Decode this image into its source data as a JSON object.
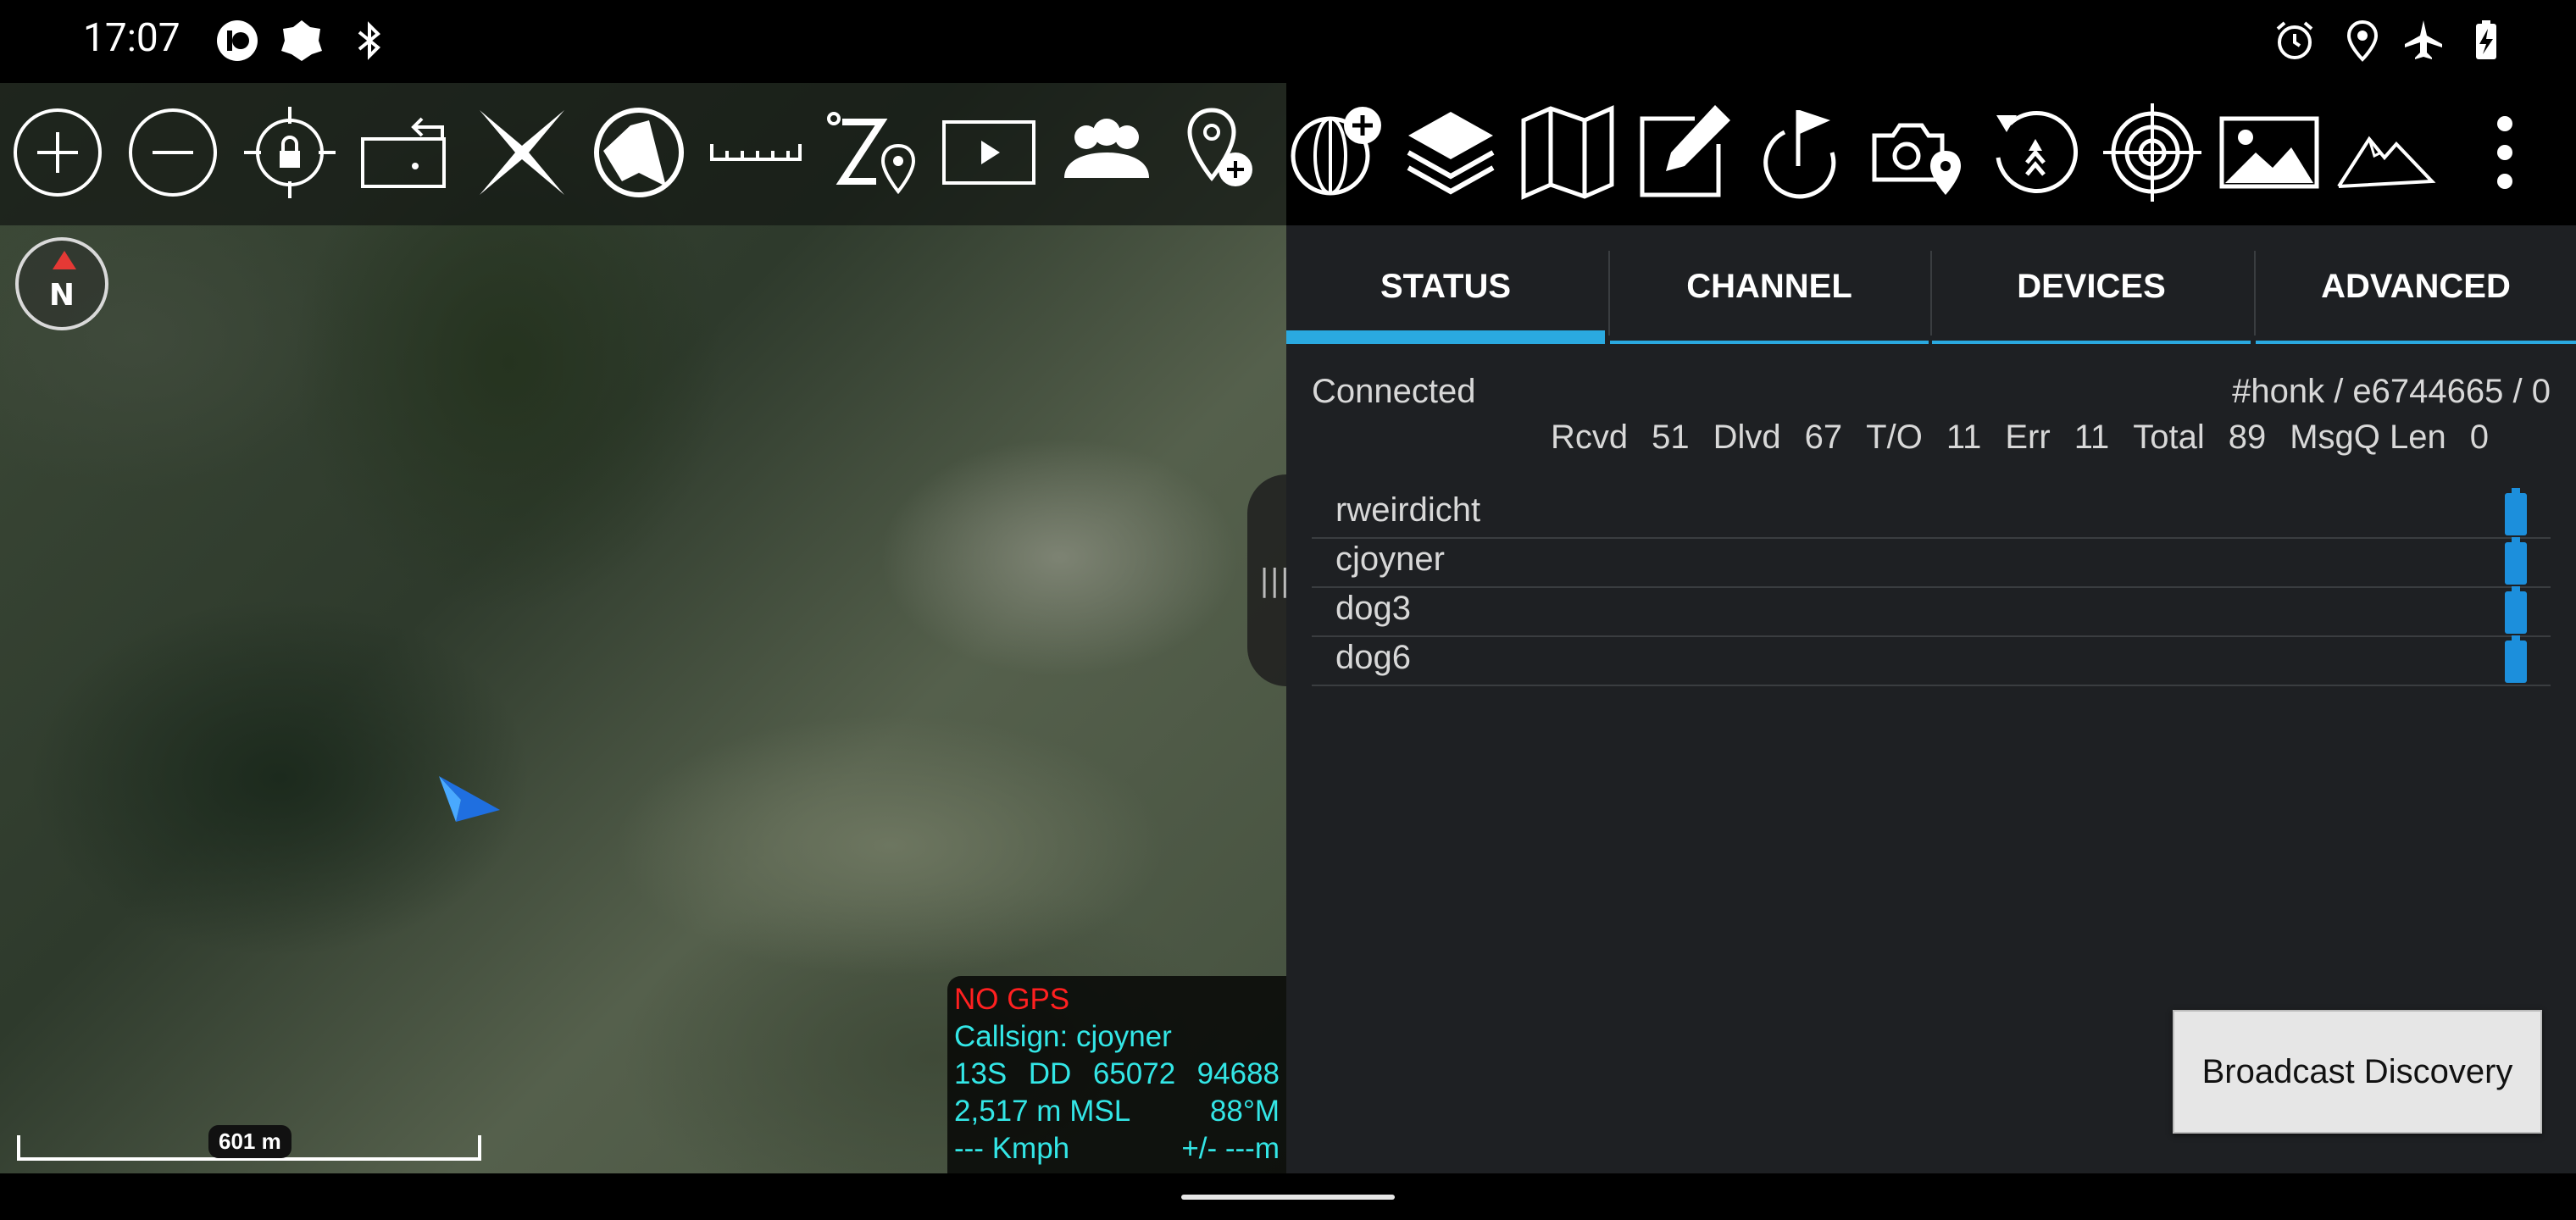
{
  "status_bar": {
    "time": "17:07",
    "left_icons": [
      "app-icon",
      "notification-icon",
      "bluetooth-icon"
    ],
    "right_icons": [
      "alarm-icon",
      "location-icon",
      "airplane-icon",
      "battery-charging-icon"
    ]
  },
  "map_toolbar": [
    "zoom-in-icon",
    "zoom-out-icon",
    "lock-location-icon",
    "rotate-icon",
    "cancel-icon",
    "map-mode-icon",
    "ruler-icon",
    "route-icon",
    "play-icon",
    "contacts-icon",
    "add-point-icon"
  ],
  "panel_toolbar": [
    "add-globe-icon",
    "layers-icon",
    "map-icon",
    "edit-icon",
    "goto-icon",
    "camera-location-icon",
    "history-icon",
    "target-icon",
    "image-icon",
    "terrain-icon",
    "more-icon"
  ],
  "compass": {
    "label": "N"
  },
  "scale_bar": {
    "label": "601 m"
  },
  "info_box": {
    "gps_status": "NO GPS",
    "callsign": "Callsign: cjoyner",
    "grid_zone": "13S",
    "datum": "DD",
    "easting": "65072",
    "northing": "94688",
    "altitude": "2,517 m MSL",
    "heading": "88°M",
    "speed": "--- Kmph",
    "error": "+/- ---m"
  },
  "tabs": [
    {
      "label": "STATUS",
      "active": true
    },
    {
      "label": "CHANNEL",
      "active": false
    },
    {
      "label": "DEVICES",
      "active": false
    },
    {
      "label": "ADVANCED",
      "active": false
    }
  ],
  "status": {
    "connection": "Connected",
    "channel_info": "#honk / e6744665 / 0",
    "stats": [
      {
        "label": "Rcvd",
        "value": "51"
      },
      {
        "label": "Dlvd",
        "value": "67"
      },
      {
        "label": "T/O",
        "value": "11"
      },
      {
        "label": "Err",
        "value": "11"
      },
      {
        "label": "Total",
        "value": "89"
      },
      {
        "label": "MsgQ Len",
        "value": "0"
      }
    ]
  },
  "devices": [
    "rweirdicht",
    "cjoyner",
    "dog3",
    "dog6"
  ],
  "broadcast_button": "Broadcast Discovery",
  "colors": {
    "accent": "#2aa9e0",
    "gps_error": "#ff2020",
    "info_text": "#33e6e6",
    "battery": "#1c8fdc"
  }
}
